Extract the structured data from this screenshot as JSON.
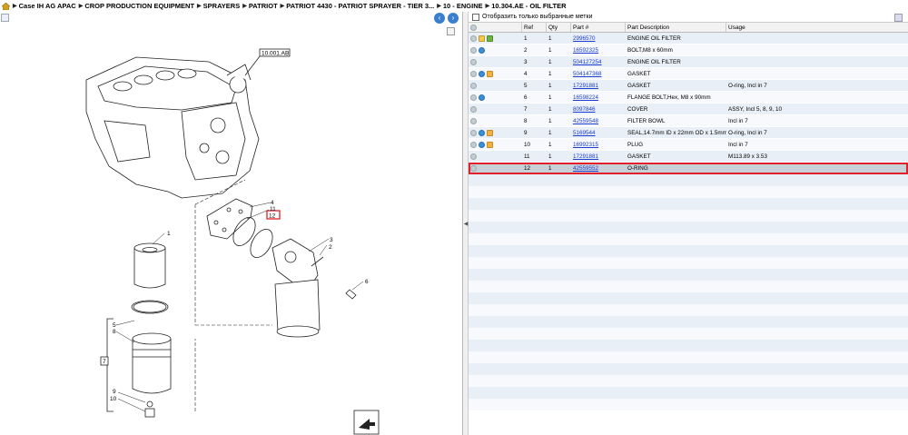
{
  "breadcrumbs": [
    "Case IH AG APAC",
    "CROP PRODUCTION EQUIPMENT",
    "SPRAYERS",
    "PATRIOT",
    "PATRIOT 4430 - PATRIOT SPRAYER - TIER 3...",
    "10 - ENGINE",
    "10.304.AE - OIL FILTER"
  ],
  "diagram": {
    "ref_box": "10.001.AB",
    "callouts": {
      "c1": "1",
      "c2": "2",
      "c3": "3",
      "c4": "4",
      "c5": "5",
      "c6": "6",
      "c7": "7",
      "c8": "8",
      "c9": "9",
      "c10": "10",
      "c11": "11",
      "c12": "12"
    }
  },
  "filter": {
    "label": "Отобразить только выбранные метки"
  },
  "table": {
    "headers": {
      "ref": "Ref",
      "qty": "Qty",
      "part": "Part #",
      "desc": "Part Description",
      "usage": "Usage"
    },
    "rows": [
      {
        "ref": "1",
        "qty": "1",
        "part": "2996570",
        "desc": "ENGINE OIL FILTER",
        "usage": "",
        "icons": [
          "a",
          "g"
        ]
      },
      {
        "ref": "2",
        "qty": "1",
        "part": "16592325",
        "desc": "BOLT,M8 x 60mm",
        "usage": "",
        "icons": [
          "b"
        ]
      },
      {
        "ref": "3",
        "qty": "1",
        "part": "504127254",
        "desc": "ENGINE OIL FILTER",
        "usage": "",
        "icons": []
      },
      {
        "ref": "4",
        "qty": "1",
        "part": "504147368",
        "desc": "GASKET",
        "usage": "",
        "icons": [
          "b",
          "y"
        ]
      },
      {
        "ref": "5",
        "qty": "1",
        "part": "17291881",
        "desc": "GASKET",
        "usage": "O-ring, Incl in 7",
        "icons": []
      },
      {
        "ref": "6",
        "qty": "1",
        "part": "16598224",
        "desc": "FLANGE BOLT,Hex, M8 x 90mm",
        "usage": "",
        "icons": [
          "b"
        ]
      },
      {
        "ref": "7",
        "qty": "1",
        "part": "8097846",
        "desc": "COVER",
        "usage": "ASSY, Incl 5, 8, 9, 10",
        "icons": []
      },
      {
        "ref": "8",
        "qty": "1",
        "part": "42559548",
        "desc": "FILTER BOWL",
        "usage": "Incl in 7",
        "icons": []
      },
      {
        "ref": "9",
        "qty": "1",
        "part": "5169544",
        "desc": "SEAL,14.7mm ID x 22mm OD x 1.5mm Thk",
        "usage": "O-ring, Incl in 7",
        "icons": [
          "b",
          "y"
        ]
      },
      {
        "ref": "10",
        "qty": "1",
        "part": "16992315",
        "desc": "PLUG",
        "usage": "Incl in 7",
        "icons": [
          "b",
          "y"
        ]
      },
      {
        "ref": "11",
        "qty": "1",
        "part": "17291881",
        "desc": "GASKET",
        "usage": "M113.89 x 3.53",
        "icons": []
      },
      {
        "ref": "12",
        "qty": "1",
        "part": "42559552",
        "desc": "O-RING",
        "usage": "",
        "icons": []
      }
    ]
  }
}
